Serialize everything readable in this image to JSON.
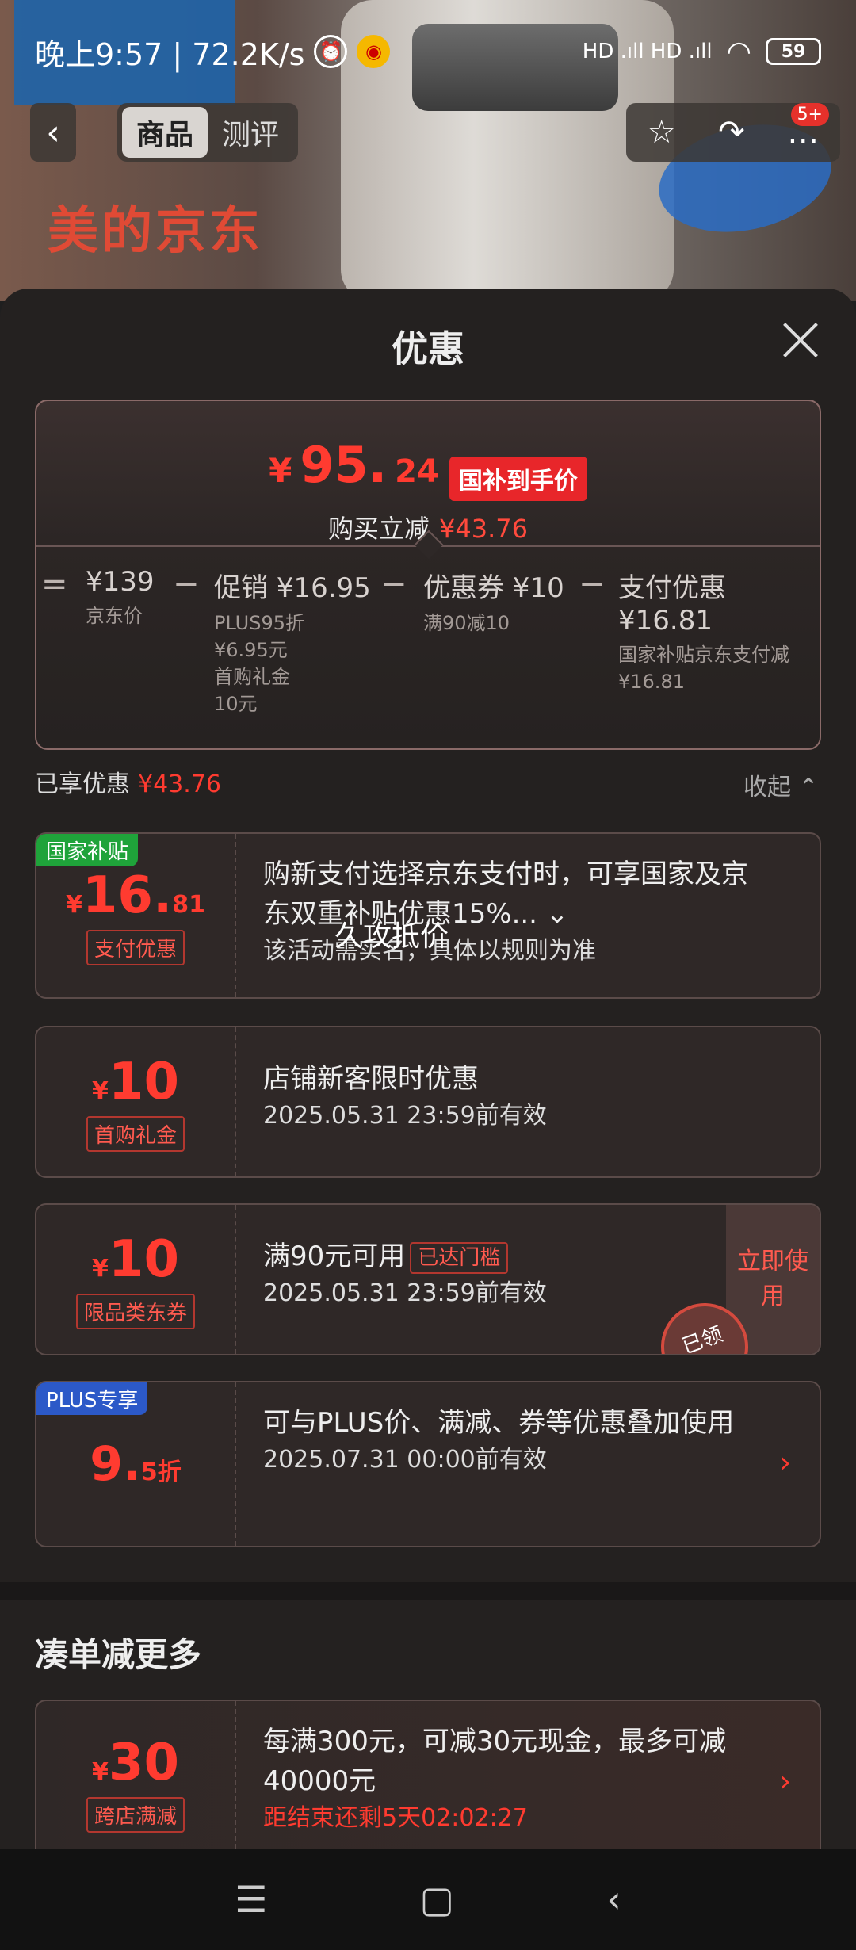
{
  "status_bar": {
    "time_speed": "晚上9:57 | 72.2K/s",
    "network": "HD .ıll HD .ıll",
    "battery": "59"
  },
  "banner": {
    "text": "美的京东"
  },
  "nav": {
    "back": "‹",
    "tabs": [
      {
        "label": "商品"
      },
      {
        "label": "测评"
      }
    ],
    "tools": {
      "star": "☆",
      "share": "↷",
      "more": "…",
      "badge": "5+"
    }
  },
  "sheet": {
    "title": "优惠",
    "summary": {
      "currency": "¥",
      "price_int": "95.",
      "price_dec": "24",
      "price_tag": "国补到手价",
      "buy_label": "购买立减",
      "buy_amount": "¥43.76",
      "breakdown": [
        {
          "main": "¥139",
          "sub": "京东价"
        },
        {
          "main": "促销 ¥16.95",
          "sub": "PLUS95折\n¥6.95元\n首购礼金\n10元"
        },
        {
          "main": "优惠券 ¥10",
          "sub": "满90减10"
        },
        {
          "main": "支付优惠 ¥16.81",
          "sub": "国家补贴京东支付减\n¥16.81"
        }
      ],
      "equals": "=",
      "minus": "−"
    },
    "enjoyed_label": "已享优惠",
    "enjoyed_amount": "¥43.76",
    "collapse_label": "收起 ⌃",
    "cards": [
      {
        "corner": "国家补贴",
        "cur": "¥",
        "int": "16.",
        "dec": "81",
        "type": "支付优惠",
        "line1": "购新支付选择京东支付时，可享国家及京东双重补贴优惠15%... ⌄",
        "line2": "该活动需实名，具体以规则为准",
        "overlay": "久攻抵价"
      },
      {
        "cur": "¥",
        "int": "10",
        "dec": "",
        "type": "首购礼金",
        "line1": "店铺新客限时优惠",
        "line2": "2025.05.31 23:59前有效"
      },
      {
        "cur": "¥",
        "int": "10",
        "dec": "",
        "type": "限品类东券",
        "line1": "满90元可用",
        "line1_tag": "已达门槛",
        "line2": "2025.05.31 23:59前有效",
        "btn": "立即使用",
        "stamp": "已领"
      },
      {
        "corner": "PLUS专享",
        "int": "9.",
        "dec": "5折",
        "line1": "可与PLUS价、满减、券等优惠叠加使用",
        "line2": "2025.07.31 00:00前有效",
        "chev": "›"
      }
    ],
    "more_title": "凑单减更多",
    "more_card": {
      "cur": "¥",
      "int": "30",
      "type": "跨店满减",
      "line1": "每满300元，可减30元现金，最多可减40000元",
      "line2": "距结束还剩5天02:02:27",
      "chev": "›"
    }
  },
  "navbar": {
    "menu": "☰",
    "home": "▢",
    "back": "‹"
  },
  "colors": {
    "accent": "#ff3b30",
    "gov_green": "#1fa33a",
    "plus_blue": "#2c59c8"
  }
}
